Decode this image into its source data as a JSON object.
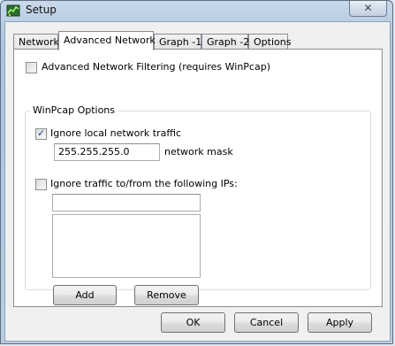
{
  "window": {
    "title": "Setup",
    "close_glyph": "✕"
  },
  "tabs": [
    {
      "label": "Network",
      "active": false
    },
    {
      "label": "Advanced Network",
      "active": true
    },
    {
      "label": "Graph -1",
      "active": false
    },
    {
      "label": "Graph -2",
      "active": false
    },
    {
      "label": "Options",
      "active": false
    }
  ],
  "advanced": {
    "filtering_label": "Advanced Network Filtering (requires WinPcap)",
    "filtering_checked": false,
    "group_title": "WinPcap Options",
    "ignore_local_label": "Ignore local network traffic",
    "ignore_local_checked": true,
    "mask_value": "255.255.255.0",
    "mask_label": "network mask",
    "ignore_ips_label": "Ignore traffic to/from the following IPs:",
    "ignore_ips_checked": false,
    "ip_input_value": "",
    "add_label": "Add",
    "remove_label": "Remove"
  },
  "footer": {
    "ok": "OK",
    "cancel": "Cancel",
    "apply": "Apply"
  },
  "icons": {
    "app": "network-monitor-icon",
    "close": "close-icon",
    "check": "checkmark-icon"
  },
  "colors": {
    "check_mark": "#1c3f80",
    "panel": "#ffffff",
    "dialog": "#f0f0f0"
  }
}
